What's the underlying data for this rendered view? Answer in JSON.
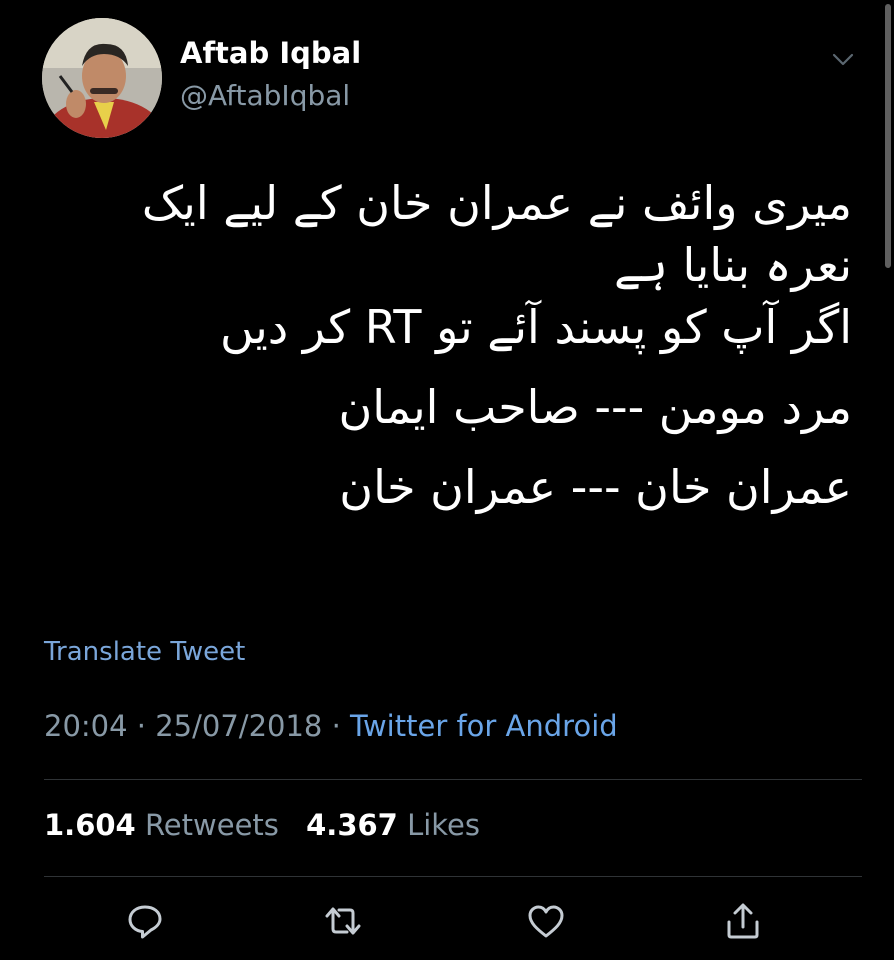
{
  "user": {
    "name": "Aftab Iqbal",
    "handle": "@AftabIqbal"
  },
  "tweet": {
    "lines": [
      "میری وائف نے عمران خان کے لیے ایک",
      "نعرہ بنایا ہے",
      "اگر آپ کو پسند آئے تو RT کر دیں",
      "مرد مومن --- صاحب ایمان",
      "عمران خان --- عمران خان"
    ]
  },
  "translate_label": "Translate Tweet",
  "meta": {
    "time": "20:04",
    "separator": "·",
    "date": "25/07/2018",
    "source": "Twitter for Android"
  },
  "stats": {
    "retweets_count": "1.604",
    "retweets_label": "Retweets",
    "likes_count": "4.367",
    "likes_label": "Likes"
  },
  "icons": {
    "chevron": "chevron-down-icon",
    "reply": "reply-icon",
    "retweet": "retweet-icon",
    "like": "heart-icon",
    "share": "share-icon"
  },
  "colors": {
    "background": "#000000",
    "muted": "#8899a6",
    "link": "#6aa5e8",
    "divider": "#2f3336"
  }
}
